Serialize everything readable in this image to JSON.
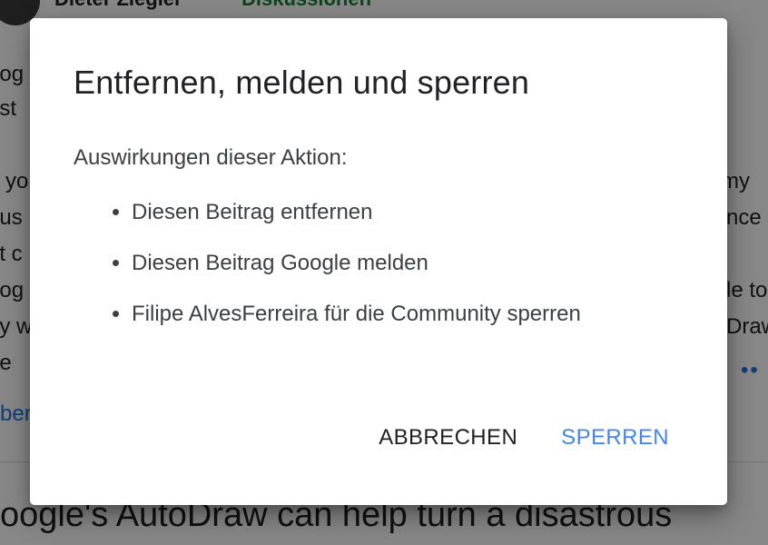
{
  "background": {
    "author": "Dieter Ziegler",
    "status": "Diskussionen",
    "lines": [
      "oog",
      "ast",
      "o yo",
      "ous",
      "at c",
      "oog",
      "ay w",
      "pe",
      " my",
      "nce",
      "le to",
      "Draw"
    ],
    "dots": "••",
    "link": "ber",
    "heading": "oogle's AutoDraw can help turn a disastrous"
  },
  "dialog": {
    "title": "Entfernen, melden und sperren",
    "intro": "Auswirkungen dieser Aktion:",
    "items": [
      "Diesen Beitrag entfernen",
      "Diesen Beitrag Google melden",
      "Filipe AlvesFerreira für die Community sperren"
    ],
    "cancel_label": "ABBRECHEN",
    "confirm_label": "SPERREN"
  },
  "colors": {
    "confirm": "#4285f4",
    "status": "#188038",
    "link": "#1a73e8"
  }
}
